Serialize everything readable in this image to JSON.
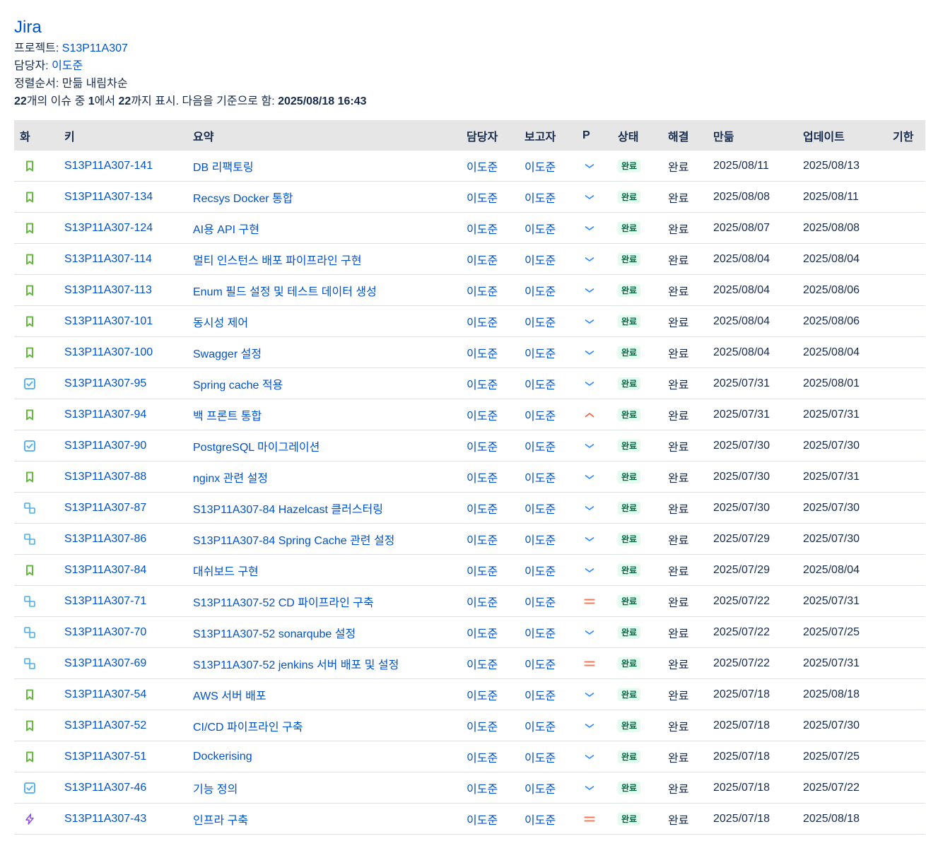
{
  "header": {
    "title": "Jira",
    "project_label": "프로젝트:",
    "project_value": "S13P11A307",
    "assignee_label": "담당자:",
    "assignee_value": "이도준",
    "sort_label": "정렬순서:",
    "sort_value": "만듦 내림차순",
    "count_total": "22",
    "count_text1": "개의 이슈 중 ",
    "count_from": "1",
    "count_text2": "에서 ",
    "count_to": "22",
    "count_text3": "까지 표시. 다음을 기준으로 함: ",
    "count_date": "2025/08/18 16:43"
  },
  "columns": {
    "type": "화",
    "key": "키",
    "summary": "요약",
    "assignee": "담당자",
    "reporter": "보고자",
    "priority": "P",
    "status": "상태",
    "resolution": "해결",
    "created": "만듦",
    "updated": "업데이트",
    "due": "기한"
  },
  "colors": {
    "story": "#63ba3c",
    "task": "#4bade8",
    "subtask": "#4bade8",
    "epic": "#904ee2",
    "priority_low": "#2684ff",
    "priority_high": "#ff5630",
    "priority_medium": "#ff7452",
    "status_done_bg": "#e3fcef",
    "status_done_text": "#006644",
    "link": "#0052cc"
  },
  "rows": [
    {
      "type": "story-icon",
      "key": "S13P11A307-141",
      "summary": "DB 리팩토링",
      "assignee": "이도준",
      "reporter": "이도준",
      "priority": "low-priority-icon",
      "status": "완료",
      "resolution": "완료",
      "created": "2025/08/11",
      "updated": "2025/08/13",
      "due": ""
    },
    {
      "type": "story-icon",
      "key": "S13P11A307-134",
      "summary": "Recsys Docker 통합",
      "assignee": "이도준",
      "reporter": "이도준",
      "priority": "low-priority-icon",
      "status": "완료",
      "resolution": "완료",
      "created": "2025/08/08",
      "updated": "2025/08/11",
      "due": ""
    },
    {
      "type": "story-icon",
      "key": "S13P11A307-124",
      "summary": "AI용 API 구현",
      "assignee": "이도준",
      "reporter": "이도준",
      "priority": "low-priority-icon",
      "status": "완료",
      "resolution": "완료",
      "created": "2025/08/07",
      "updated": "2025/08/08",
      "due": ""
    },
    {
      "type": "story-icon",
      "key": "S13P11A307-114",
      "summary": "멀티 인스턴스 배포 파이프라인 구현",
      "assignee": "이도준",
      "reporter": "이도준",
      "priority": "low-priority-icon",
      "status": "완료",
      "resolution": "완료",
      "created": "2025/08/04",
      "updated": "2025/08/04",
      "due": ""
    },
    {
      "type": "story-icon",
      "key": "S13P11A307-113",
      "summary": "Enum 필드 설정 및 테스트 데이터 생성",
      "assignee": "이도준",
      "reporter": "이도준",
      "priority": "low-priority-icon",
      "status": "완료",
      "resolution": "완료",
      "created": "2025/08/04",
      "updated": "2025/08/06",
      "due": ""
    },
    {
      "type": "story-icon",
      "key": "S13P11A307-101",
      "summary": "동시성 제어",
      "assignee": "이도준",
      "reporter": "이도준",
      "priority": "low-priority-icon",
      "status": "완료",
      "resolution": "완료",
      "created": "2025/08/04",
      "updated": "2025/08/06",
      "due": ""
    },
    {
      "type": "story-icon",
      "key": "S13P11A307-100",
      "summary": "Swagger 설정",
      "assignee": "이도준",
      "reporter": "이도준",
      "priority": "low-priority-icon",
      "status": "완료",
      "resolution": "완료",
      "created": "2025/08/04",
      "updated": "2025/08/04",
      "due": ""
    },
    {
      "type": "task-icon",
      "key": "S13P11A307-95",
      "summary": "Spring cache 적용",
      "assignee": "이도준",
      "reporter": "이도준",
      "priority": "low-priority-icon",
      "status": "완료",
      "resolution": "완료",
      "created": "2025/07/31",
      "updated": "2025/08/01",
      "due": ""
    },
    {
      "type": "story-icon",
      "key": "S13P11A307-94",
      "summary": "백 프론트 통합",
      "assignee": "이도준",
      "reporter": "이도준",
      "priority": "high-priority-icon",
      "status": "완료",
      "resolution": "완료",
      "created": "2025/07/31",
      "updated": "2025/07/31",
      "due": ""
    },
    {
      "type": "task-icon",
      "key": "S13P11A307-90",
      "summary": "PostgreSQL 마이그레이션",
      "assignee": "이도준",
      "reporter": "이도준",
      "priority": "low-priority-icon",
      "status": "완료",
      "resolution": "완료",
      "created": "2025/07/30",
      "updated": "2025/07/30",
      "due": ""
    },
    {
      "type": "story-icon",
      "key": "S13P11A307-88",
      "summary": "nginx 관련 설정",
      "assignee": "이도준",
      "reporter": "이도준",
      "priority": "low-priority-icon",
      "status": "완료",
      "resolution": "완료",
      "created": "2025/07/30",
      "updated": "2025/07/31",
      "due": ""
    },
    {
      "type": "subtask-icon",
      "key": "S13P11A307-87",
      "summary": "S13P11A307-84 Hazelcast 클러스터링",
      "assignee": "이도준",
      "reporter": "이도준",
      "priority": "low-priority-icon",
      "status": "완료",
      "resolution": "완료",
      "created": "2025/07/30",
      "updated": "2025/07/30",
      "due": ""
    },
    {
      "type": "subtask-icon",
      "key": "S13P11A307-86",
      "summary": "S13P11A307-84 Spring Cache 관련 설정",
      "assignee": "이도준",
      "reporter": "이도준",
      "priority": "low-priority-icon",
      "status": "완료",
      "resolution": "완료",
      "created": "2025/07/29",
      "updated": "2025/07/30",
      "due": ""
    },
    {
      "type": "story-icon",
      "key": "S13P11A307-84",
      "summary": "대쉬보드 구현",
      "assignee": "이도준",
      "reporter": "이도준",
      "priority": "low-priority-icon",
      "status": "완료",
      "resolution": "완료",
      "created": "2025/07/29",
      "updated": "2025/08/04",
      "due": ""
    },
    {
      "type": "subtask-icon",
      "key": "S13P11A307-71",
      "summary": "S13P11A307-52 CD 파이프라인 구축",
      "assignee": "이도준",
      "reporter": "이도준",
      "priority": "medium-priority-icon",
      "status": "완료",
      "resolution": "완료",
      "created": "2025/07/22",
      "updated": "2025/07/31",
      "due": ""
    },
    {
      "type": "subtask-icon",
      "key": "S13P11A307-70",
      "summary": "S13P11A307-52 sonarqube 설정",
      "assignee": "이도준",
      "reporter": "이도준",
      "priority": "low-priority-icon",
      "status": "완료",
      "resolution": "완료",
      "created": "2025/07/22",
      "updated": "2025/07/25",
      "due": ""
    },
    {
      "type": "subtask-icon",
      "key": "S13P11A307-69",
      "summary": "S13P11A307-52 jenkins 서버 배포 및 설정",
      "assignee": "이도준",
      "reporter": "이도준",
      "priority": "medium-priority-icon",
      "status": "완료",
      "resolution": "완료",
      "created": "2025/07/22",
      "updated": "2025/07/31",
      "due": ""
    },
    {
      "type": "story-icon",
      "key": "S13P11A307-54",
      "summary": "AWS 서버 배포",
      "assignee": "이도준",
      "reporter": "이도준",
      "priority": "low-priority-icon",
      "status": "완료",
      "resolution": "완료",
      "created": "2025/07/18",
      "updated": "2025/08/18",
      "due": ""
    },
    {
      "type": "story-icon",
      "key": "S13P11A307-52",
      "summary": "CI/CD 파이프라인 구축",
      "assignee": "이도준",
      "reporter": "이도준",
      "priority": "low-priority-icon",
      "status": "완료",
      "resolution": "완료",
      "created": "2025/07/18",
      "updated": "2025/07/30",
      "due": ""
    },
    {
      "type": "story-icon",
      "key": "S13P11A307-51",
      "summary": "Dockerising",
      "assignee": "이도준",
      "reporter": "이도준",
      "priority": "low-priority-icon",
      "status": "완료",
      "resolution": "완료",
      "created": "2025/07/18",
      "updated": "2025/07/25",
      "due": ""
    },
    {
      "type": "task-icon",
      "key": "S13P11A307-46",
      "summary": "기능 정의",
      "assignee": "이도준",
      "reporter": "이도준",
      "priority": "low-priority-icon",
      "status": "완료",
      "resolution": "완료",
      "created": "2025/07/18",
      "updated": "2025/07/22",
      "due": ""
    },
    {
      "type": "epic-icon",
      "key": "S13P11A307-43",
      "summary": "인프라 구축",
      "assignee": "이도준",
      "reporter": "이도준",
      "priority": "medium-priority-icon",
      "status": "완료",
      "resolution": "완료",
      "created": "2025/07/18",
      "updated": "2025/08/18",
      "due": ""
    }
  ]
}
